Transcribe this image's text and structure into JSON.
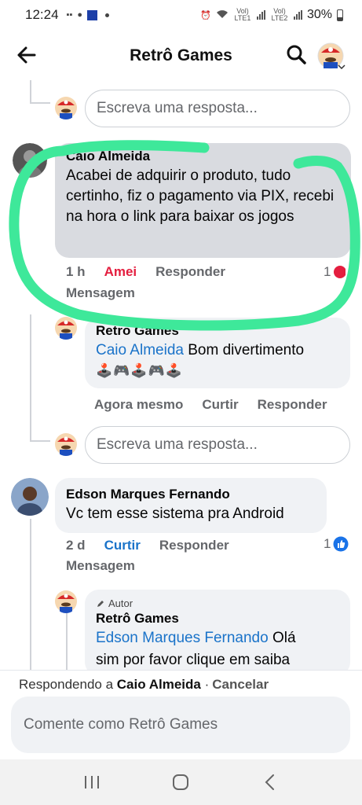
{
  "status_bar": {
    "time": "12:24",
    "signal1_label": "Vol) LTE1",
    "signal2_label": "Vol) LTE2",
    "battery": "30%"
  },
  "header": {
    "title": "Retrô Games"
  },
  "reply_placeholder": "Escreva uma resposta...",
  "comments": [
    {
      "author": "Caio Almeida",
      "text": "Acabei de adquirir o produto, tudo certinho, fiz o pagamento via PIX, recebi na hora o link para baixar os jogos",
      "time": "1 h",
      "reaction": "Amei",
      "reply": "Responder",
      "message": "Mensagem",
      "reaction_count": "1"
    },
    {
      "author": "Retro Games",
      "mention": "Caio Almeida",
      "text": " Bom divertimento",
      "emojis": "🕹️🎮🕹️🎮🕹️",
      "time": "Agora mesmo",
      "like": "Curtir",
      "reply": "Responder"
    },
    {
      "author": "Edson Marques Fernando",
      "text": "Vc tem esse sistema pra Android",
      "time": "2 d",
      "like": "Curtir",
      "reply": "Responder",
      "message": "Mensagem",
      "reaction_count": "1"
    },
    {
      "author_tag": "Autor",
      "author": "Retrô Games",
      "mention": "Edson Marques Fernando",
      "text_line1": " Olá",
      "text_line2": "sim por favor clique em saiba"
    }
  ],
  "footer": {
    "replying_prefix": "Respondendo a",
    "replying_name": "Caio Almeida",
    "separator": "·",
    "cancel": "Cancelar",
    "compose_placeholder": "Comente como Retrô Games"
  },
  "colors": {
    "annotation": "#3ee89a",
    "link": "#1a73c9",
    "love": "#e41e3f"
  }
}
